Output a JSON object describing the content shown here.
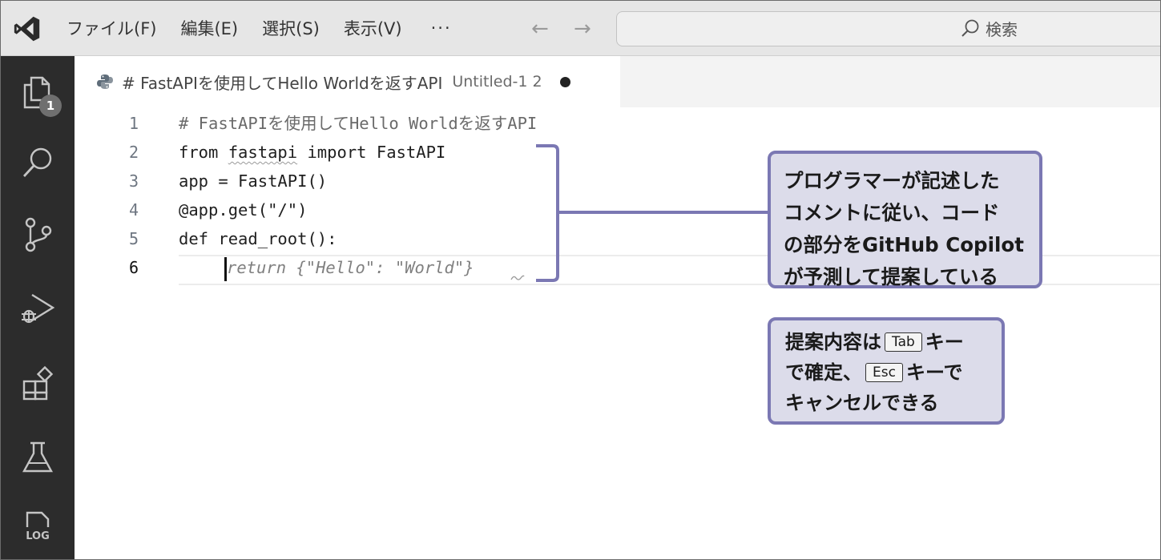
{
  "menu": {
    "items": [
      "ファイル(F)",
      "編集(E)",
      "選択(S)",
      "表示(V)"
    ],
    "more": "···"
  },
  "nav": {
    "back": "←",
    "forward": "→"
  },
  "search": {
    "label": "検索"
  },
  "activity": {
    "explorer_badge": "1",
    "log_label": "LOG"
  },
  "tab": {
    "title": "# FastAPIを使用してHello Worldを返すAPI",
    "description": "Untitled-1 2"
  },
  "editor": {
    "lines": [
      {
        "number": "1",
        "text": "# FastAPIを使用してHello Worldを返すAPI"
      },
      {
        "number": "2",
        "kw1": "from",
        "module": "fastapi",
        "kw2": "import",
        "name": "FastAPI"
      },
      {
        "number": "3",
        "text": "app = FastAPI()"
      },
      {
        "number": "4",
        "text": "@app.get(\"/\")"
      },
      {
        "number": "5",
        "text": "def read_root():"
      },
      {
        "number": "6",
        "ghost": "return {\"Hello\": \"World\"}"
      }
    ]
  },
  "callouts": {
    "suggestion": {
      "lines": [
        "プログラマーが記述した",
        "コメントに従い、コード",
        "の部分をGitHub Copilot",
        "が予測して提案している"
      ]
    },
    "accept": {
      "line1_pre": "提案内容は",
      "tab_key": "Tab",
      "line1_post": "キー",
      "line2_pre": "で確定、",
      "esc_key": "Esc",
      "line2_post": "キーで",
      "line3": "キャンセルできる"
    }
  },
  "colors": {
    "callout_border": "#7b78b3",
    "callout_fill": "#dcdcea",
    "activitybar": "#2c2c2c"
  }
}
